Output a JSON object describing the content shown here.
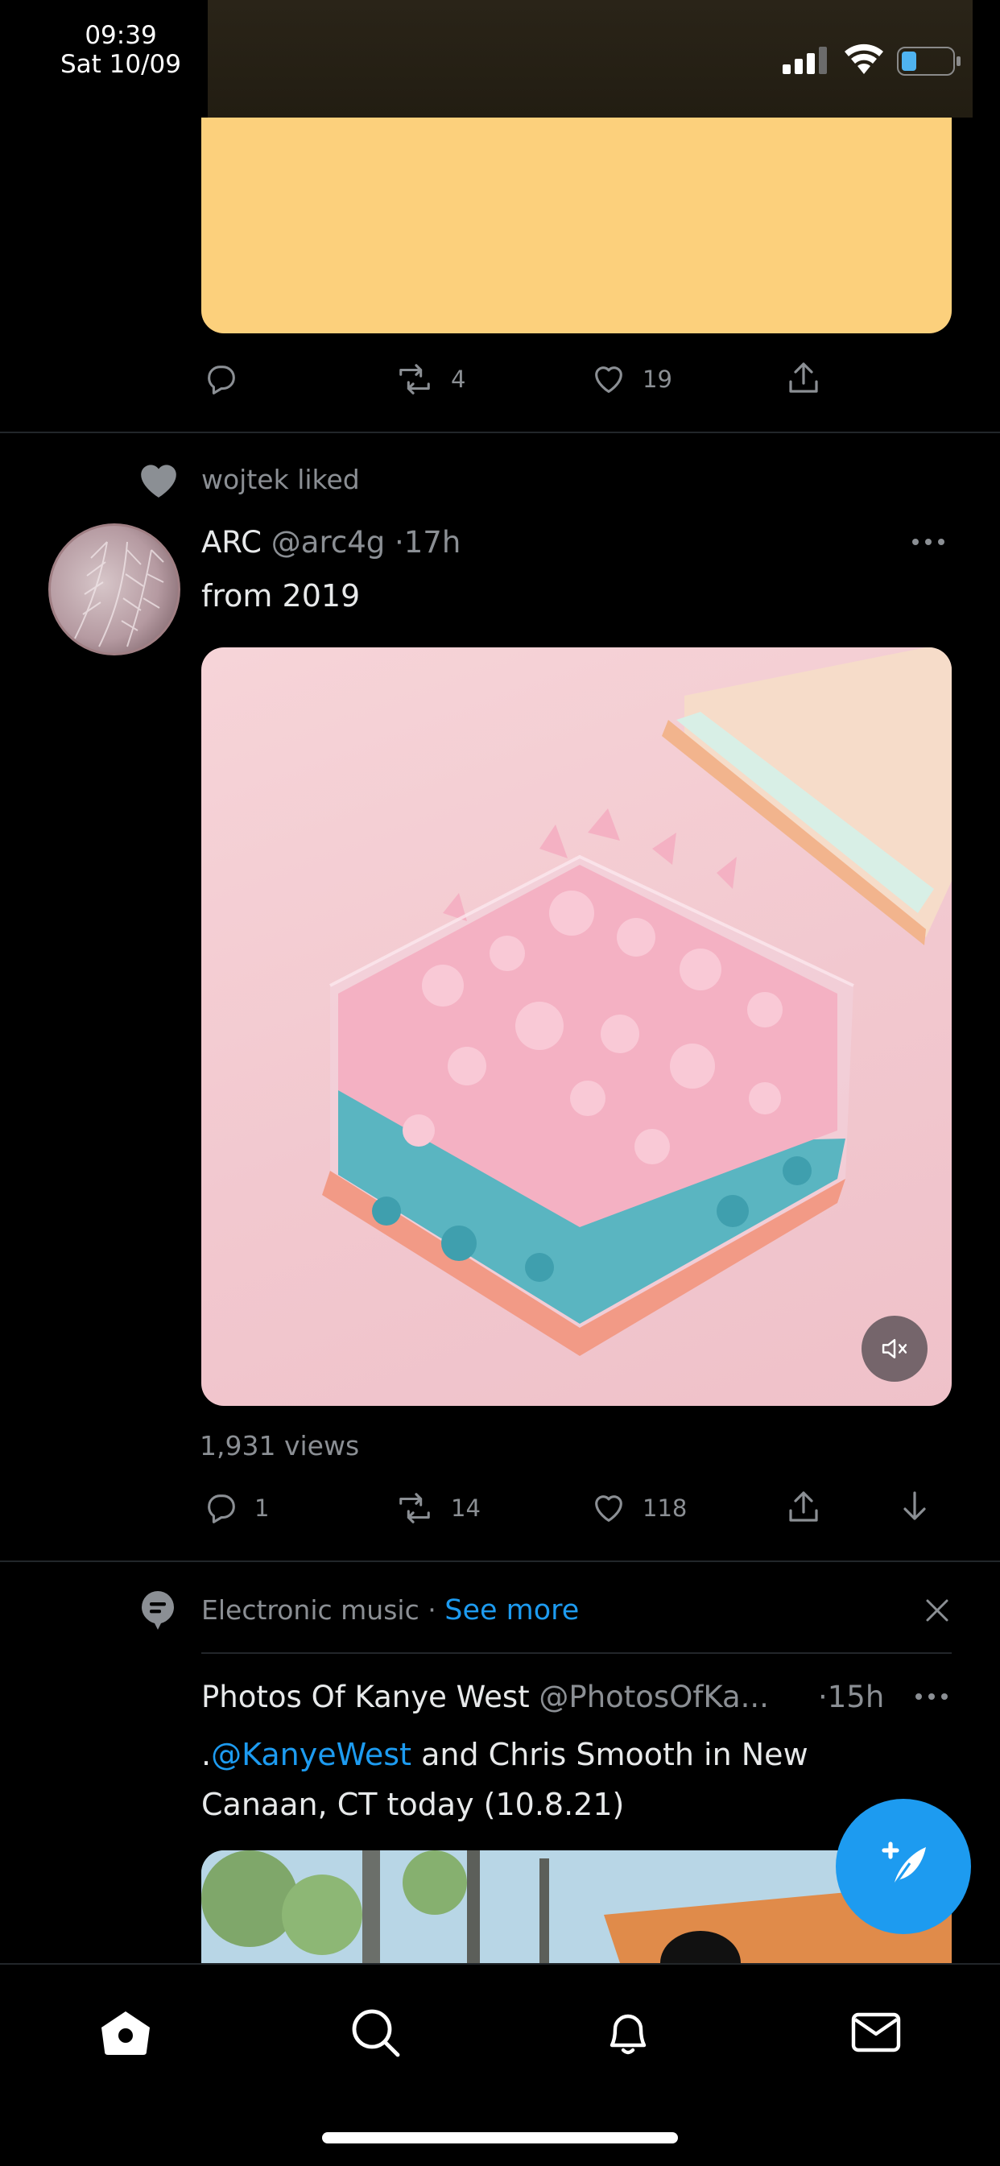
{
  "status_bar": {
    "time": "09:39",
    "date": "Sat 10/09"
  },
  "prev_tweet": {
    "card_color": "#fcd07c",
    "actions": {
      "reply": "",
      "retweets": "4",
      "likes": "19"
    }
  },
  "tweet1": {
    "social_context": "wojtek liked",
    "name": "ARC",
    "handle": "@arc4g",
    "time": "·17h",
    "text": "from 2019",
    "views": "1,931 views",
    "actions": {
      "replies": "1",
      "retweets": "14",
      "likes": "118"
    }
  },
  "topic_row": {
    "topic": "Electronic music",
    "separator": "·",
    "see_more": "See more"
  },
  "tweet2": {
    "name": "Photos Of Kanye West",
    "handle": "@PhotosOfKa...",
    "time": "·15h",
    "text_prefix": ".",
    "mention": "@KanyeWest",
    "text_line1_rest": " and Chris Smooth in New",
    "text_line2": "Canaan, CT today (10.8.21)"
  },
  "colors": {
    "accent": "#1d9bf0",
    "background": "#000000"
  },
  "icons": [
    "reply-icon",
    "retweet-icon",
    "like-icon",
    "share-icon",
    "download-icon",
    "more-icon",
    "mute-icon",
    "compose-icon",
    "home-icon",
    "search-icon",
    "notifications-icon",
    "messages-icon",
    "topic-icon",
    "close-icon",
    "heart-filled-icon"
  ]
}
